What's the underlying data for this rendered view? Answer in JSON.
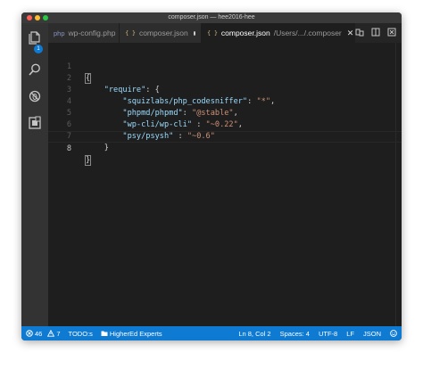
{
  "window": {
    "title": "composer.json — hee2016-hee"
  },
  "activity": {
    "badge": "1"
  },
  "tabs": [
    {
      "label": "wp-config.php",
      "icon": "php-file-icon"
    },
    {
      "label": "composer.json",
      "icon": "json-braces-icon",
      "dirty": true
    },
    {
      "label": "composer.json",
      "path": "/Users/.../.composer",
      "icon": "json-braces-icon",
      "active": true
    }
  ],
  "editor": {
    "lines": [
      {
        "num": "1",
        "text": "{"
      },
      {
        "num": "2",
        "text": "    \"require\": {"
      },
      {
        "num": "3",
        "text": "        \"squizlabs/php_codesniffer\": \"*\","
      },
      {
        "num": "4",
        "text": "        \"phpmd/phpmd\": \"@stable\","
      },
      {
        "num": "5",
        "text": "        \"wp-cli/wp-cli\" : \"~0.22\","
      },
      {
        "num": "6",
        "text": "        \"psy/psysh\" : \"~0.6\""
      },
      {
        "num": "7",
        "text": "    }"
      },
      {
        "num": "8",
        "text": "}"
      }
    ],
    "tokens": {
      "l1": "{",
      "l2_key": "\"require\"",
      "l2_rest": ": {",
      "l3_key": "\"squizlabs/php_codesniffer\"",
      "l3_sep": ": ",
      "l3_val": "\"*\"",
      "l3_end": ",",
      "l4_key": "\"phpmd/phpmd\"",
      "l4_sep": ": ",
      "l4_val": "\"@stable\"",
      "l4_end": ",",
      "l5_key": "\"wp-cli/wp-cli\"",
      "l5_sep": " : ",
      "l5_val": "\"~0.22\"",
      "l5_end": ",",
      "l6_key": "\"psy/psysh\"",
      "l6_sep": " : ",
      "l6_val": "\"~0.6\"",
      "l7": "}",
      "l8": "}"
    }
  },
  "statusbar": {
    "errors": "46",
    "warnings": "7",
    "todo": "TODO:s",
    "folder": "HigherEd Experts",
    "position": "Ln 8, Col 2",
    "spaces": "Spaces: 4",
    "encoding": "UTF-8",
    "eol": "LF",
    "language": "JSON"
  },
  "colors": {
    "editor_bg": "#1e1e1e",
    "statusbar_bg": "#0e7ad2",
    "json_key": "#9cdcfe",
    "json_string": "#ce9178"
  }
}
